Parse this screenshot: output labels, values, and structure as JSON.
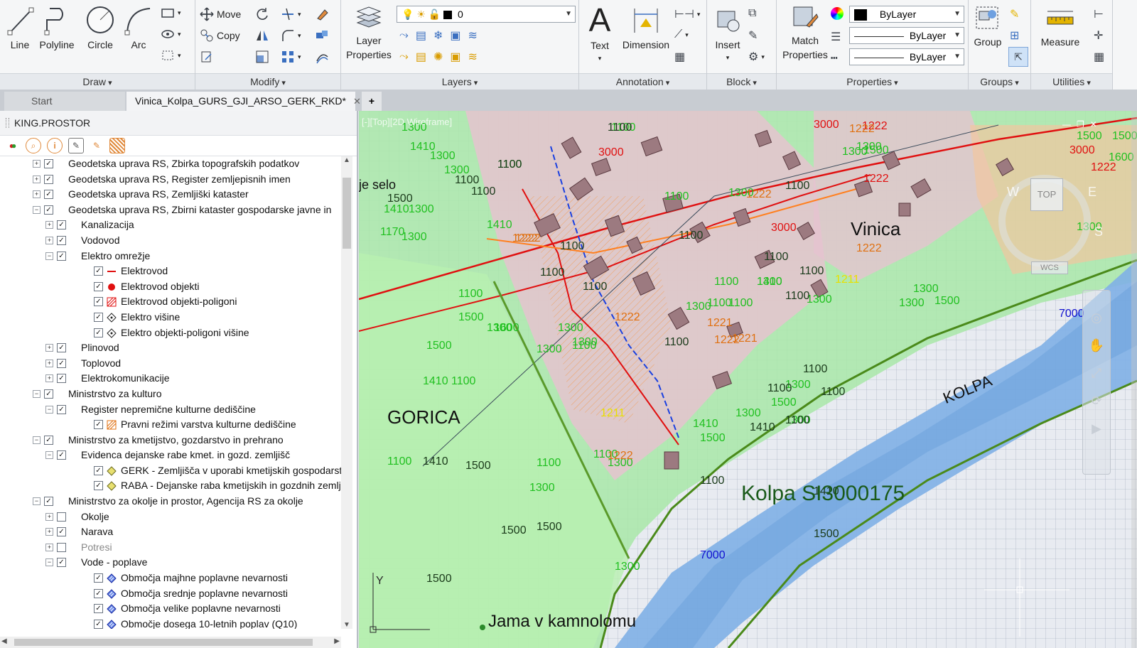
{
  "ribbon": {
    "draw": {
      "title": "Draw",
      "tools": [
        "Line",
        "Polyline",
        "Circle",
        "Arc"
      ]
    },
    "modify": {
      "title": "Modify",
      "move": "Move",
      "copy": "Copy"
    },
    "layers": {
      "title": "Layers",
      "properties": "Layer Properties",
      "current_layer": "0"
    },
    "annotation": {
      "title": "Annotation",
      "text": "Text",
      "dimension": "Dimension"
    },
    "block": {
      "title": "Block",
      "insert": "Insert"
    },
    "properties": {
      "title": "Properties",
      "match": "Match Properties",
      "color": "ByLayer",
      "linetype": "ByLayer",
      "lineweight": "ByLayer"
    },
    "groups": {
      "title": "Groups",
      "group": "Group"
    },
    "utilities": {
      "title": "Utilities",
      "measure": "Measure"
    }
  },
  "tabs": {
    "start": "Start",
    "drawing": "Vinica_Kolpa_GURS_GJI_ARSO_GERK_RKD*",
    "plus": "+"
  },
  "panel": {
    "title": "KING.PROSTOR",
    "tree": [
      {
        "label": "Geodetska uprava RS, Zbirka topografskih podatkov",
        "level": 0,
        "exp": "+",
        "checked": true
      },
      {
        "label": "Geodetska uprava RS, Register zemljepisnih imen",
        "level": 0,
        "exp": "+",
        "checked": true
      },
      {
        "label": "Geodetska uprava RS, Zemljiški kataster",
        "level": 0,
        "exp": "+",
        "checked": true
      },
      {
        "label": "Geodetska uprava RS, Zbirni kataster gospodarske javne in",
        "level": 0,
        "exp": "-",
        "checked": true
      },
      {
        "label": "Kanalizacija",
        "level": 1,
        "exp": "+",
        "checked": true
      },
      {
        "label": "Vodovod",
        "level": 1,
        "exp": "+",
        "checked": true
      },
      {
        "label": "Elektro omrežje",
        "level": 1,
        "exp": "-",
        "checked": true
      },
      {
        "label": "Elektrovod",
        "level": 2,
        "checked": true,
        "sym": "line-red"
      },
      {
        "label": "Elektrovod objekti",
        "level": 2,
        "checked": true,
        "sym": "dot-red"
      },
      {
        "label": "Elektrovod objekti-poligoni",
        "level": 2,
        "checked": true,
        "sym": "hatch-red"
      },
      {
        "label": "Elektro višine",
        "level": 2,
        "checked": true,
        "sym": "diamond"
      },
      {
        "label": "Elektro objekti-poligoni višine",
        "level": 2,
        "checked": true,
        "sym": "diamond"
      },
      {
        "label": "Plinovod",
        "level": 1,
        "exp": "+",
        "checked": true
      },
      {
        "label": "Toplovod",
        "level": 1,
        "exp": "+",
        "checked": true
      },
      {
        "label": "Elektrokomunikacije",
        "level": 1,
        "exp": "+",
        "checked": true
      },
      {
        "label": "Ministrstvo za kulturo",
        "level": 0,
        "exp": "-",
        "checked": true
      },
      {
        "label": "Register nepremične kulturne dediščine",
        "level": 1,
        "exp": "-",
        "checked": true
      },
      {
        "label": "Pravni režimi varstva kulturne dediščine",
        "level": 2,
        "checked": true,
        "sym": "hatch-orange"
      },
      {
        "label": "Ministrstvo za kmetijstvo, gozdarstvo in prehrano",
        "level": 0,
        "exp": "-",
        "checked": true
      },
      {
        "label": "Evidenca dejanske rabe kmet. in gozd. zemljišč",
        "level": 1,
        "exp": "-",
        "checked": true
      },
      {
        "label": "GERK - Zemljišča v uporabi kmetijskih gospodarstev",
        "level": 2,
        "checked": true,
        "sym": "hatch-olive"
      },
      {
        "label": "RABA - Dejanske raba kmetijskih in gozdnih zemljišč",
        "level": 2,
        "checked": true,
        "sym": "hatch-olive"
      },
      {
        "label": "Ministrstvo za okolje in prostor, Agencija RS za okolje",
        "level": 0,
        "exp": "-",
        "checked": true
      },
      {
        "label": "Okolje",
        "level": 1,
        "exp": "+",
        "checked": false
      },
      {
        "label": "Narava",
        "level": 1,
        "exp": "+",
        "checked": true
      },
      {
        "label": "Potresi",
        "level": 1,
        "exp": "+",
        "checked": false,
        "gray": true
      },
      {
        "label": "Vode - poplave",
        "level": 1,
        "exp": "-",
        "checked": true
      },
      {
        "label": "Območja majhne poplavne nevarnosti",
        "level": 2,
        "checked": true,
        "sym": "hatch-blue"
      },
      {
        "label": "Območja srednje poplavne nevarnosti",
        "level": 2,
        "checked": true,
        "sym": "hatch-blue"
      },
      {
        "label": "Območja velike poplavne nevarnosti",
        "level": 2,
        "checked": true,
        "sym": "hatch-blue"
      },
      {
        "label": "Območje dosega 10-letnih poplav (Q10)",
        "level": 2,
        "checked": true,
        "sym": "hatch-blue"
      }
    ]
  },
  "viewport": {
    "label": "[-][Top][2D Wireframe]",
    "nav_top": "TOP",
    "nav_w": "W",
    "nav_e": "E",
    "nav_s": "S",
    "wcs": "WCS",
    "place_vinica": "Vinica",
    "place_gorica": "GORICA",
    "place_selo": "je selo",
    "river_label": "KOLPA",
    "river_code": "Kolpa SI3000175",
    "cave": "Jama v kamnolomu",
    "axis_y": "Y",
    "codes_green": [
      "1300",
      "1100",
      "1100",
      "1300",
      "1410",
      "1300",
      "1100",
      "1500",
      "1410",
      "1300",
      "1170",
      "1300",
      "1410",
      "1100",
      "1300",
      "1300",
      "1300",
      "1600",
      "1300",
      "1300",
      "1410",
      "1100",
      "1500",
      "1300",
      "1500",
      "1410",
      "1500",
      "1300",
      "1300",
      "1500",
      "1300",
      "1500",
      "1300",
      "1300",
      "1600",
      "1500",
      "1300",
      "1300",
      "1100",
      "1100",
      "1100",
      "1100",
      "1300",
      "1100",
      "1100",
      "1300",
      "1300",
      "1410",
      "1300",
      "1100",
      "1300",
      "1500",
      "1300",
      "1600",
      "1500"
    ],
    "codes_dark": [
      "1100",
      "1100",
      "1100",
      "1100",
      "1100",
      "1100",
      "1100",
      "1100",
      "1100",
      "1100",
      "1100",
      "1100",
      "1100",
      "1100",
      "1100",
      "1500",
      "1500",
      "1500",
      "1500",
      "1410",
      "1410",
      "1500",
      "1410",
      "1100",
      "1100",
      "1500",
      "1100"
    ],
    "codes_red": [
      "3000",
      "3000",
      "3000",
      "1222",
      "3000",
      "1222",
      "1222"
    ],
    "codes_orange": [
      "1222",
      "1222",
      "1222",
      "1222",
      "1221",
      "1222",
      "1222",
      "1221",
      "1222",
      "1222"
    ],
    "codes_yellow": [
      "1211",
      "1211"
    ],
    "codes_blue": [
      "7000",
      "7000"
    ]
  }
}
